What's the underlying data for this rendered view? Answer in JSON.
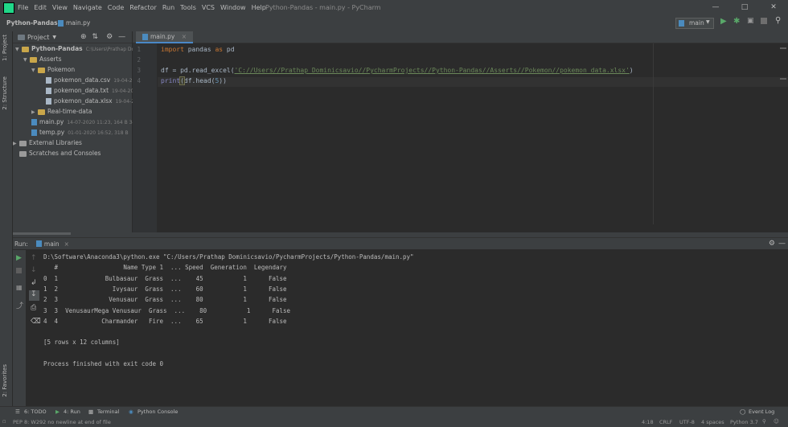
{
  "menubar": {
    "items": [
      "File",
      "Edit",
      "View",
      "Navigate",
      "Code",
      "Refactor",
      "Run",
      "Tools",
      "VCS",
      "Window",
      "Help"
    ],
    "title": "Python-Pandas - main.py - PyCharm"
  },
  "navbar": {
    "project": "Python-Pandas",
    "file": "main.py",
    "run_config": "main"
  },
  "project_panel": {
    "title": "Project",
    "tree": [
      {
        "label": "Python-Pandas",
        "meta": "C:\\Users\\Prathap Do",
        "kind": "folder",
        "depth": 0
      },
      {
        "label": "Asserts",
        "meta": "",
        "kind": "folder",
        "depth": 1
      },
      {
        "label": "Pokemon",
        "meta": "",
        "kind": "folder",
        "depth": 2
      },
      {
        "label": "pokemon_data.csv",
        "meta": "19-04-2",
        "kind": "file",
        "depth": 3
      },
      {
        "label": "pokemon_data.txt",
        "meta": "19-04-20",
        "kind": "file",
        "depth": 3
      },
      {
        "label": "pokemon_data.xlsx",
        "meta": "19-04-2",
        "kind": "file",
        "depth": 3
      },
      {
        "label": "Real-time-data",
        "meta": "",
        "kind": "folder",
        "depth": 2
      },
      {
        "label": "main.py",
        "meta": "14-07-2020 11:23, 164 B 34",
        "kind": "py",
        "depth": 1
      },
      {
        "label": "temp.py",
        "meta": "01-01-2020 16:52, 318 B",
        "kind": "py",
        "depth": 1
      },
      {
        "label": "External Libraries",
        "meta": "",
        "kind": "lib",
        "depth": 0
      },
      {
        "label": "Scratches and Consoles",
        "meta": "",
        "kind": "lib",
        "depth": 0
      }
    ]
  },
  "editor": {
    "tab": "main.py",
    "line_numbers": [
      "1",
      "2",
      "3",
      "4"
    ],
    "line1": {
      "kw": "import",
      "rest": " pandas ",
      "kw2": "as",
      "rest2": " pd"
    },
    "line3": {
      "pre": "df = pd.read_excel(",
      "str": "'C://Users//Prathap Dominicsavio//PycharmProjects//Python-Pandas//Asserts//Pokemon//pokemon_data.xlsx'",
      "post": ")"
    },
    "line4": {
      "fn": "print",
      "open": "(",
      "mid": "df.head(",
      "num": "5",
      "close": "))"
    }
  },
  "run": {
    "label": "Run:",
    "config": "main",
    "console": [
      "D:\\Software\\Anaconda3\\python.exe \"C:/Users/Prathap Dominicsavio/PycharmProjects/Python-Pandas/main.py\"",
      "   #                  Name Type 1  ... Speed  Generation  Legendary",
      "0  1             Bulbasaur  Grass  ...    45           1      False",
      "1  2               Ivysaur  Grass  ...    60           1      False",
      "2  3              Venusaur  Grass  ...    80           1      False",
      "3  3  VenusaurMega Venusaur  Grass  ...    80           1      False",
      "4  4            Charmander   Fire  ...    65           1      False",
      "",
      "[5 rows x 12 columns]",
      "",
      "Process finished with exit code 0"
    ]
  },
  "left_strip": {
    "project": "1: Project",
    "structure": "2: Structure",
    "favorites": "2: Favorites"
  },
  "bottom_tabs": {
    "todo": "6: TODO",
    "run": "4: Run",
    "terminal": "Terminal",
    "python_console": "Python Console",
    "event_log": "Event Log"
  },
  "status": {
    "message": "PEP 8: W292 no newline at end of file",
    "position": "4:18",
    "line_sep": "CRLF",
    "encoding": "UTF-8",
    "indent": "4 spaces",
    "interpreter": "Python 3.7"
  }
}
